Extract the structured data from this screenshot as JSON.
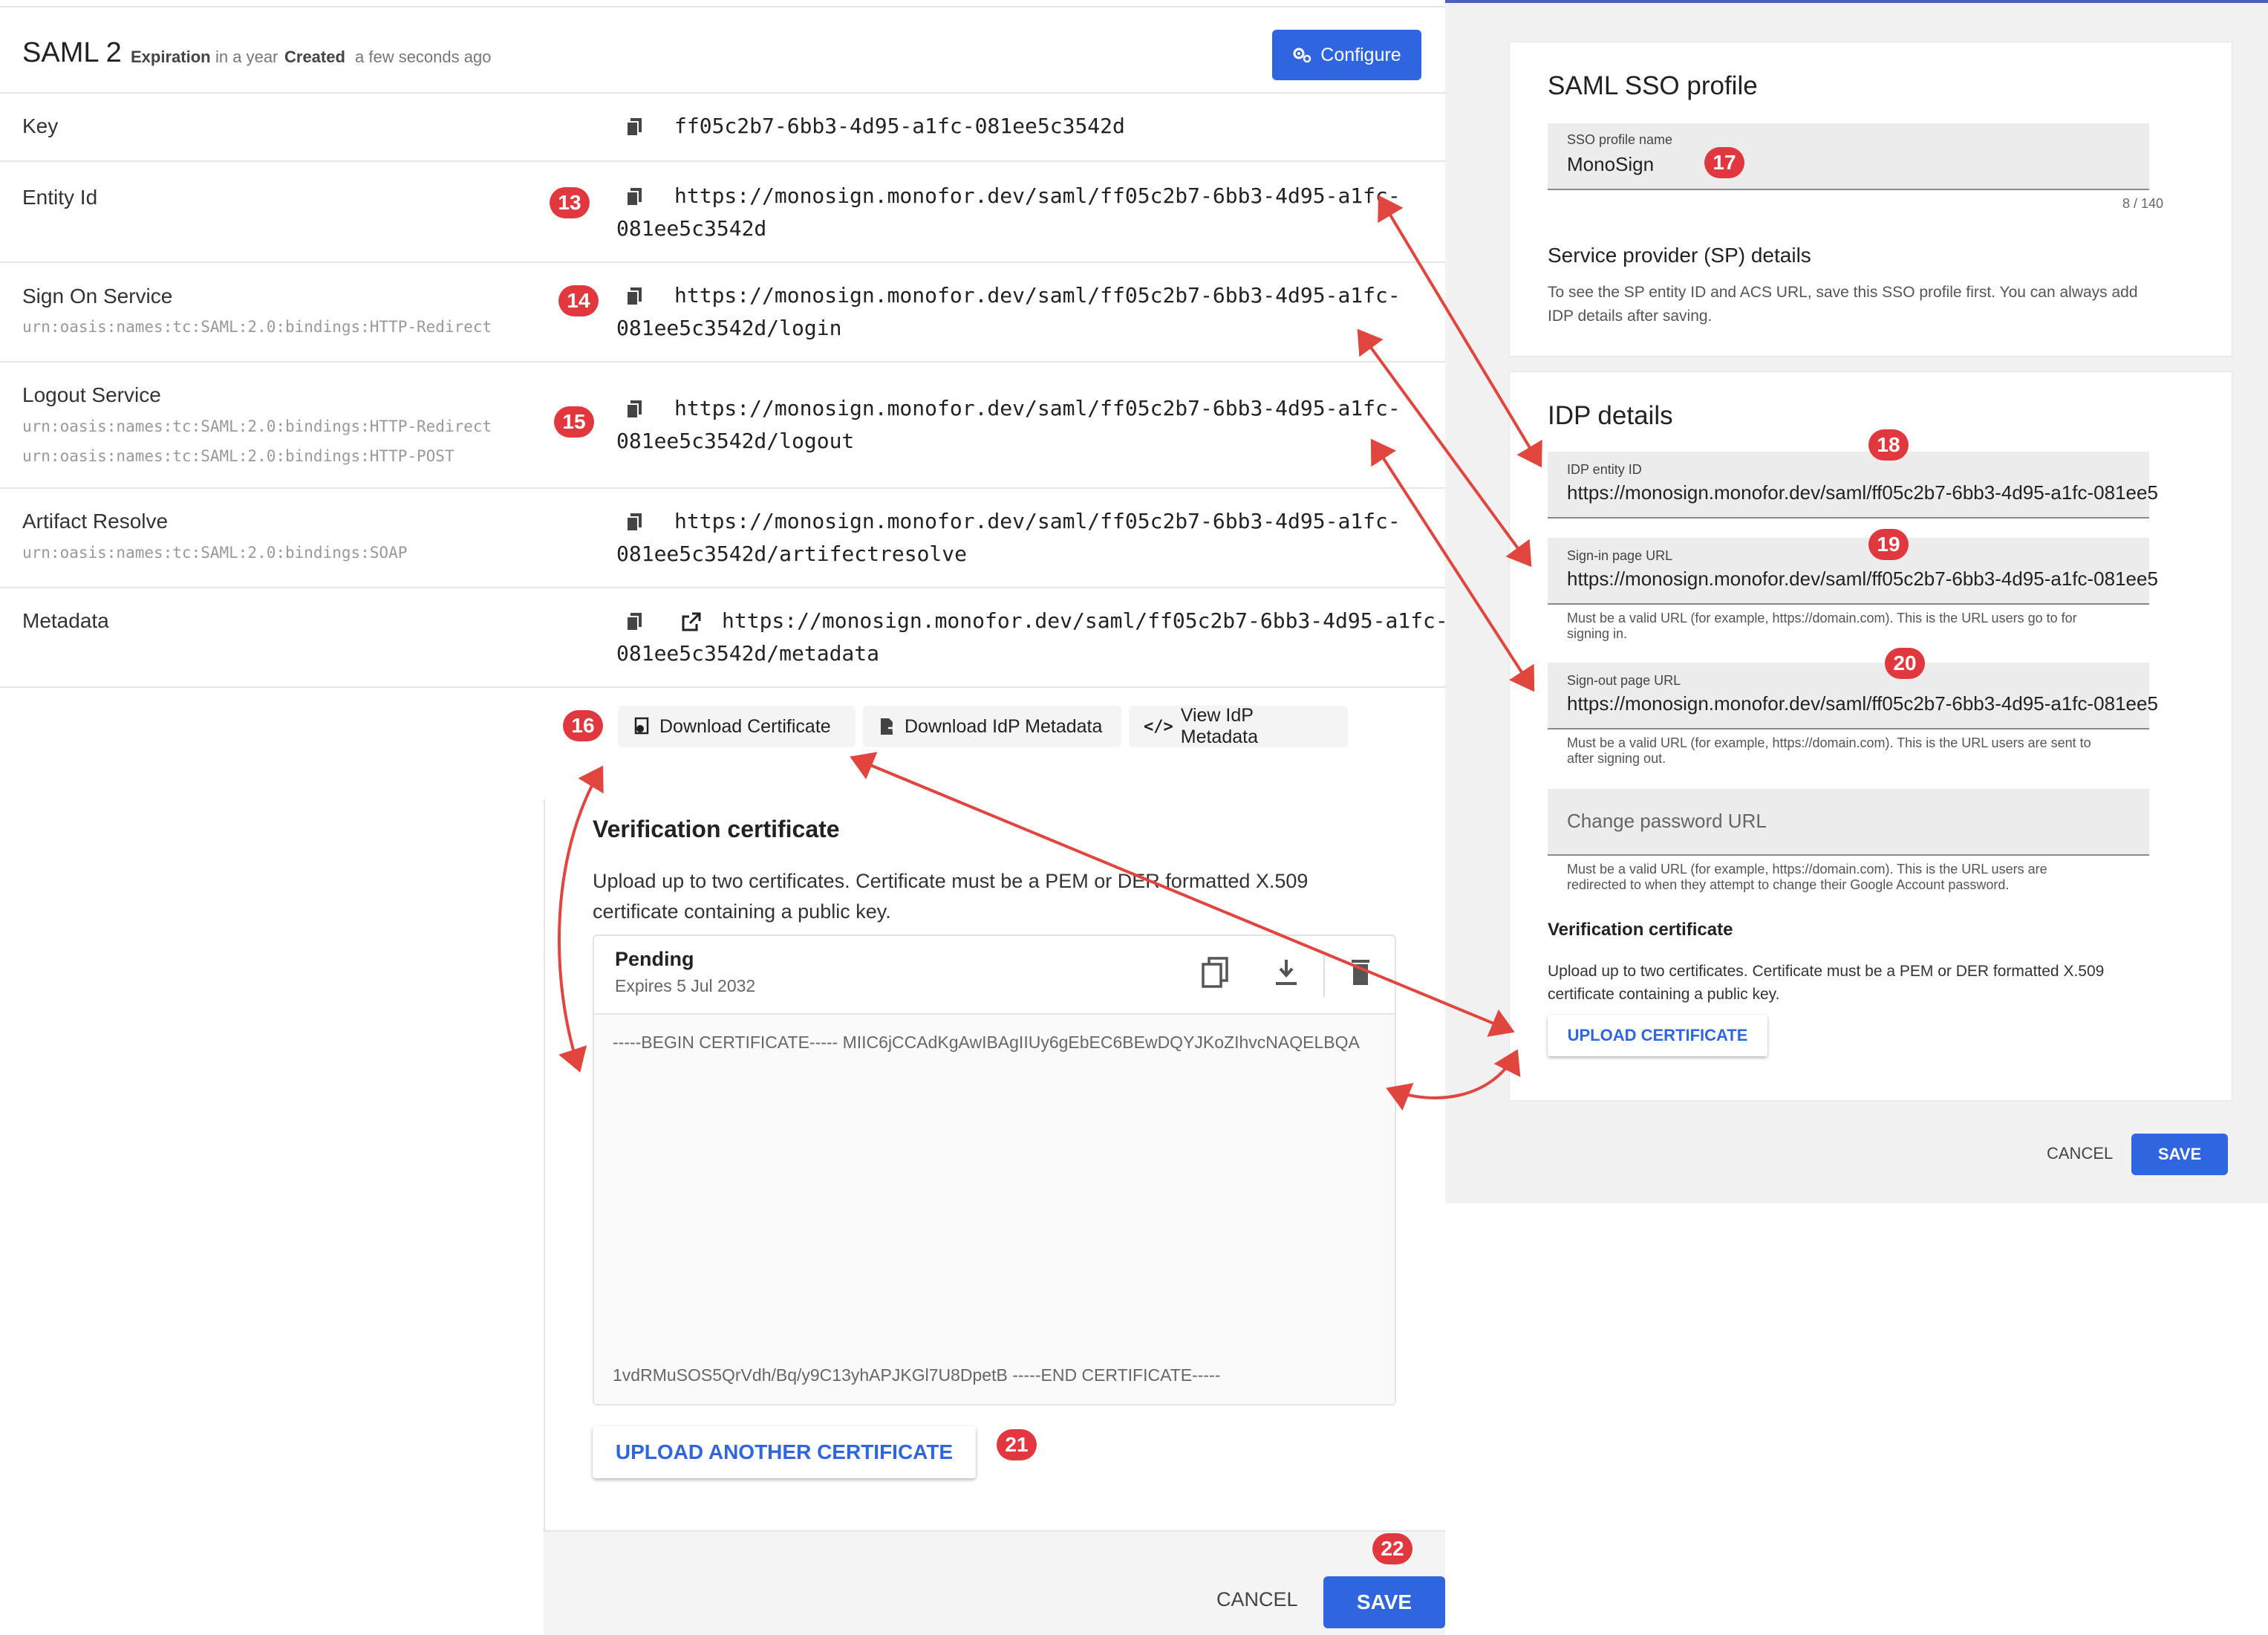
{
  "header": {
    "title": "SAML 2",
    "expiration_label": "Expiration",
    "expiration_value": "in a year",
    "created_label": "Created",
    "created_value": "a few seconds ago",
    "configure_label": "Configure"
  },
  "rows": {
    "key": {
      "label": "Key",
      "value": "ff05c2b7-6bb3-4d95-a1fc-081ee5c3542d"
    },
    "entity": {
      "label": "Entity Id",
      "value1": "https://monosign.monofor.dev/saml/ff05c2b7-6bb3-4d95-a1fc-",
      "value2": "081ee5c3542d"
    },
    "signon": {
      "label": "Sign On Service",
      "sub1": "urn:oasis:names:tc:SAML:2.0:bindings:HTTP-Redirect",
      "value1": "https://monosign.monofor.dev/saml/ff05c2b7-6bb3-4d95-a1fc-",
      "value2": "081ee5c3542d/login"
    },
    "logout": {
      "label": "Logout Service",
      "sub1": "urn:oasis:names:tc:SAML:2.0:bindings:HTTP-Redirect",
      "sub2": "urn:oasis:names:tc:SAML:2.0:bindings:HTTP-POST",
      "value1": "https://monosign.monofor.dev/saml/ff05c2b7-6bb3-4d95-a1fc-",
      "value2": "081ee5c3542d/logout"
    },
    "artifact": {
      "label": "Artifact Resolve",
      "sub1": "urn:oasis:names:tc:SAML:2.0:bindings:SOAP",
      "value1": "https://monosign.monofor.dev/saml/ff05c2b7-6bb3-4d95-a1fc-",
      "value2": "081ee5c3542d/artifectresolve"
    },
    "metadata": {
      "label": "Metadata",
      "value1": "https://monosign.monofor.dev/saml/ff05c2b7-6bb3-4d95-a1fc-",
      "value2": "081ee5c3542d/metadata"
    }
  },
  "actions": {
    "download_cert": "Download Certificate",
    "download_idp": "Download IdP Metadata",
    "view_idp": "View IdP Metadata"
  },
  "verification": {
    "title": "Verification certificate",
    "desc1": "Upload up to two certificates. Certificate must be a PEM or DER formatted X.509",
    "desc2": "certificate containing a public key.",
    "cert_status": "Pending",
    "cert_expires": "Expires 5 Jul 2032",
    "cert_begin": "-----BEGIN CERTIFICATE----- MIIC6jCCAdKgAwIBAgIIUy6gEbEC6BEwDQYJKoZIhvcNAQELBQA",
    "cert_end": "1vdRMuSOS5QrVdh/Bq/y9C13yhAPJKGl7U8DpetB -----END CERTIFICATE-----",
    "upload_another": "UPLOAD ANOTHER CERTIFICATE"
  },
  "footer_left": {
    "cancel": "CANCEL",
    "save": "SAVE"
  },
  "sso": {
    "title": "SAML SSO profile",
    "name_label": "SSO profile name",
    "name_value": "MonoSign",
    "counter": "8 / 140",
    "sp_title": "Service provider (SP) details",
    "sp_desc1": "To see the SP entity ID and ACS URL, save this SSO profile first. You can always add",
    "sp_desc2": "IDP details after saving."
  },
  "idp": {
    "title": "IDP details",
    "entity_label": "IDP entity ID",
    "entity_value": "https://monosign.monofor.dev/saml/ff05c2b7-6bb3-4d95-a1fc-081ee5",
    "signin_label": "Sign-in page URL",
    "signin_value": "https://monosign.monofor.dev/saml/ff05c2b7-6bb3-4d95-a1fc-081ee5",
    "signin_help1": "Must be a valid URL (for example, https://domain.com). This is the URL users go to for",
    "signin_help2": "signing in.",
    "signout_label": "Sign-out page URL",
    "signout_value": "https://monosign.monofor.dev/saml/ff05c2b7-6bb3-4d95-a1fc-081ee5",
    "signout_help1": "Must be a valid URL (for example, https://domain.com). This is the URL users are sent to",
    "signout_help2": "after signing out.",
    "changepw_placeholder": "Change password URL",
    "changepw_help1": "Must be a valid URL (for example, https://domain.com). This is the URL users are",
    "changepw_help2": "redirected to when they attempt to change their Google Account password.",
    "ver_title": "Verification certificate",
    "ver_desc1": "Upload up to two certificates. Certificate must be a PEM or DER formatted X.509",
    "ver_desc2": "certificate containing a public key.",
    "upload": "UPLOAD CERTIFICATE"
  },
  "footer_right": {
    "cancel": "CANCEL",
    "save": "SAVE"
  },
  "badges": {
    "b13": "13",
    "b14": "14",
    "b15": "15",
    "b16": "16",
    "b17": "17",
    "b18": "18",
    "b19": "19",
    "b20": "20",
    "b21": "21",
    "b22": "22"
  },
  "colors": {
    "primary": "#2f66e0",
    "badge": "#e0383e",
    "arrow": "#e0453e"
  }
}
